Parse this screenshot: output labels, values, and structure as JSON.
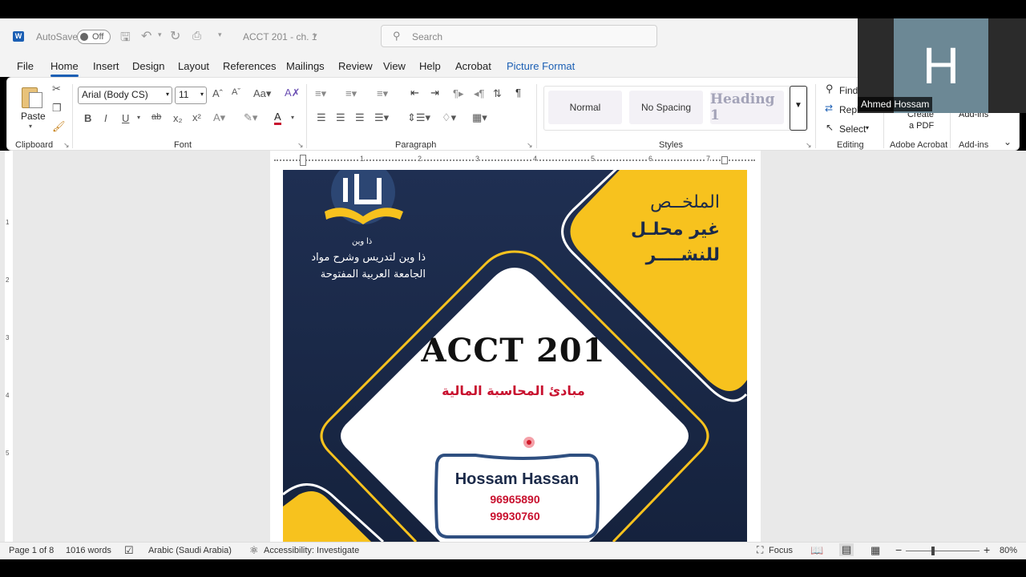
{
  "titlebar": {
    "autosave_label": "AutoSave",
    "autosave_state": "Off",
    "doc_title": "ACCT 201 - ch. 1",
    "search_placeholder": "Search"
  },
  "tabs": [
    "File",
    "Home",
    "Insert",
    "Design",
    "Layout",
    "References",
    "Mailings",
    "Review",
    "View",
    "Help",
    "Acrobat",
    "Picture Format"
  ],
  "ribbon": {
    "clipboard": {
      "paste": "Paste",
      "label": "Clipboard"
    },
    "font": {
      "name": "Arial (Body CS)",
      "size": "11",
      "label": "Font"
    },
    "paragraph": {
      "label": "Paragraph"
    },
    "styles": {
      "items": [
        "Normal",
        "No Spacing",
        "Heading 1"
      ],
      "label": "Styles"
    },
    "editing": {
      "find": "Find",
      "replace": "Repl",
      "select": "Select",
      "label": "Editing"
    },
    "acrobat": {
      "create_line1": "Create",
      "create_line2": "a PDF",
      "label": "Adobe Acrobat"
    },
    "addins": {
      "top": "Add-ins",
      "label": "Add-ins"
    }
  },
  "video": {
    "initial": "H",
    "name": "Ahmed Hossam"
  },
  "cover": {
    "logo_caption": "ذا وين",
    "tagline_1": "ذا وين لتدريس وشرح مواد",
    "tagline_2": "الجامعة العربية المفتوحة",
    "summary_1": "الملخــص",
    "summary_2": "غير محلـل",
    "summary_3": "للنشــــر",
    "course_code": "ACCT 201",
    "course_name": "مبادئ المحاسبة المالية",
    "author": "Hossam Hassan",
    "phone_1": "96965890",
    "phone_2": "99930760"
  },
  "ruler_numbers": [
    "1",
    "2",
    "3",
    "4",
    "5",
    "6",
    "7"
  ],
  "vruler_numbers": [
    "1",
    "2",
    "3",
    "4",
    "5"
  ],
  "status": {
    "page": "Page 1 of 8",
    "words": "1016 words",
    "language": "Arabic (Saudi Arabia)",
    "accessibility": "Accessibility: Investigate",
    "focus": "Focus",
    "zoom": "80%"
  },
  "colors": {
    "accent": "#1b5fb4",
    "navy": "#1b2a49",
    "gold": "#f7c21e",
    "red": "#c8102e"
  }
}
